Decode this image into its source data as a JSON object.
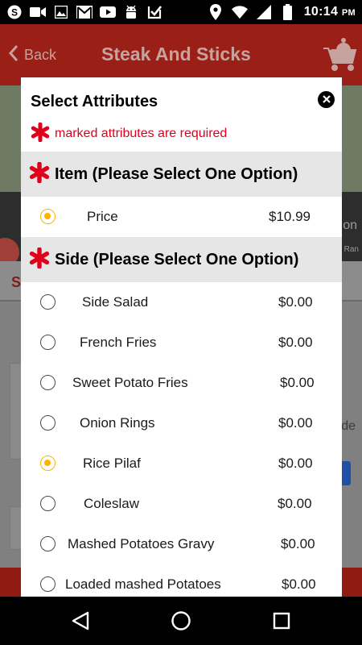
{
  "status_bar": {
    "time": "10:14",
    "ampm": "PM",
    "left_icons": [
      "skype-icon",
      "video-camera-icon",
      "image-icon",
      "gmail-icon",
      "youtube-icon",
      "android-icon",
      "checkbox-icon"
    ],
    "right_icons": [
      "location-icon",
      "wifi-icon",
      "signal-icon",
      "battery-icon"
    ]
  },
  "background_app": {
    "back_label": "Back",
    "title": "Steak And Sticks",
    "strip_text": "on",
    "strip_small": "Ran",
    "tab_letter": "S",
    "right_text": "de",
    "accent": "#9a1f16"
  },
  "modal": {
    "title": "Select Attributes",
    "required_note": "marked attributes are required",
    "required_color": "#e0001b",
    "selected_color": "#ffb300",
    "sections": [
      {
        "title": "Item (Please Select One Option)",
        "options": [
          {
            "label": "Price",
            "price": "$10.99",
            "selected": true
          }
        ]
      },
      {
        "title": "Side (Please Select One Option)",
        "options": [
          {
            "label": "Side Salad",
            "price": "$0.00",
            "selected": false
          },
          {
            "label": "French Fries",
            "price": "$0.00",
            "selected": false
          },
          {
            "label": "Sweet Potato Fries",
            "price": "$0.00",
            "selected": false
          },
          {
            "label": "Onion Rings",
            "price": "$0.00",
            "selected": false
          },
          {
            "label": "Rice Pilaf",
            "price": "$0.00",
            "selected": true
          },
          {
            "label": "Coleslaw",
            "price": "$0.00",
            "selected": false
          },
          {
            "label": "Mashed Potatoes Gravy",
            "price": "$0.00",
            "selected": false
          },
          {
            "label": "Loaded mashed Potatoes",
            "price": "$0.00",
            "selected": false
          }
        ]
      }
    ]
  },
  "nav_bar": {
    "buttons": [
      "back-triangle-icon",
      "home-circle-icon",
      "recents-square-icon"
    ]
  }
}
